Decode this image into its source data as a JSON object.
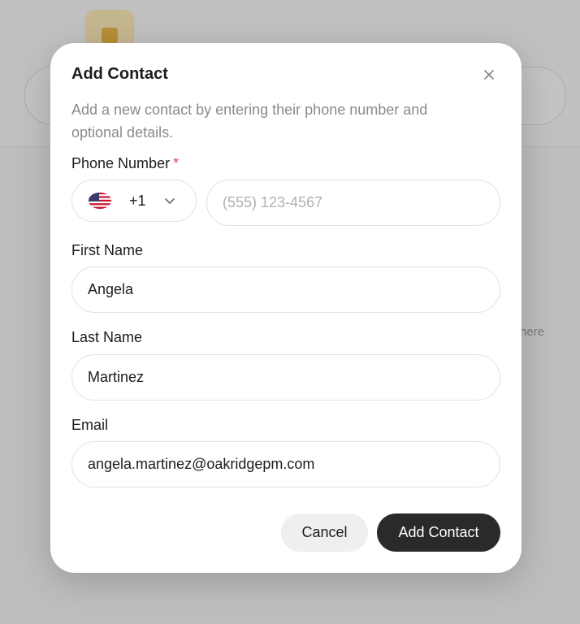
{
  "background": {
    "hint_text": "here"
  },
  "dialog": {
    "title": "Add Contact",
    "description": "Add a new contact by entering their phone number and optional details.",
    "phone": {
      "label": "Phone Number",
      "required_marker": "*",
      "country_code": "+1",
      "country_flag": "us-flag-icon",
      "placeholder": "(555) 123-4567",
      "value": ""
    },
    "first_name": {
      "label": "First Name",
      "value": "Angela"
    },
    "last_name": {
      "label": "Last Name",
      "value": "Martinez"
    },
    "email": {
      "label": "Email",
      "value": "angela.martinez@oakridgepm.com"
    },
    "actions": {
      "cancel_label": "Cancel",
      "submit_label": "Add Contact"
    }
  },
  "colors": {
    "primary_button": "#2a2a2a",
    "required_marker": "#e5484d",
    "muted_text": "#8a8a8a"
  }
}
